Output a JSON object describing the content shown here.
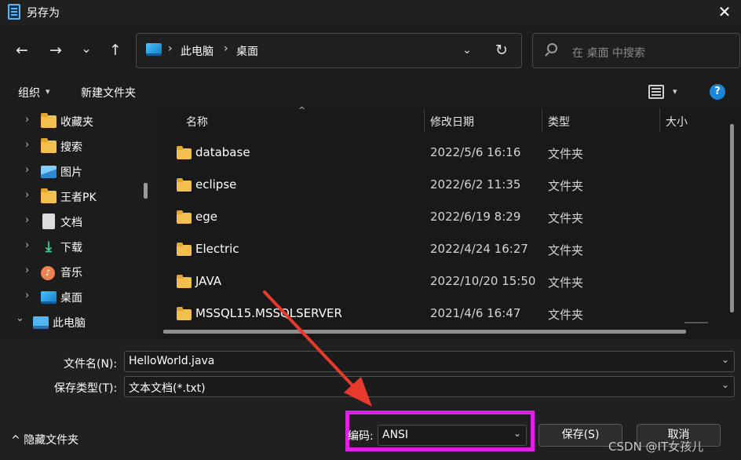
{
  "window": {
    "title": "另存为",
    "close_glyph": "✕"
  },
  "nav": {
    "back_glyph": "←",
    "forward_glyph": "→",
    "recent_glyph": "⌄",
    "up_glyph": "↑",
    "breadcrumb": [
      "此电脑",
      "桌面"
    ],
    "breadcrumb_sep": "›",
    "dropdown_glyph": "⌄",
    "refresh_glyph": "↻",
    "search_placeholder": "在 桌面 中搜索"
  },
  "commands": {
    "organize": "组织",
    "new_folder": "新建文件夹",
    "caret": "▾",
    "help": "?"
  },
  "sidebar": {
    "chevron": "›",
    "expanded_chevron": "⌄",
    "items": [
      {
        "label": "收藏夹",
        "icon": "folder-icon"
      },
      {
        "label": "搜索",
        "icon": "folder-icon"
      },
      {
        "label": "图片",
        "icon": "pictures-icon"
      },
      {
        "label": "王者PK",
        "icon": "folder-icon"
      },
      {
        "label": "文档",
        "icon": "documents-icon"
      },
      {
        "label": "下载",
        "icon": "download-icon",
        "glyph": "⤓"
      },
      {
        "label": "音乐",
        "icon": "music-icon",
        "glyph": "♪"
      },
      {
        "label": "桌面",
        "icon": "desktop-icon"
      },
      {
        "label": "此电脑",
        "icon": "pc-icon"
      }
    ]
  },
  "file_list": {
    "columns": {
      "name": "名称",
      "modified": "修改日期",
      "type": "类型",
      "size": "大小"
    },
    "sort_glyph": "^",
    "rows": [
      {
        "name": "database",
        "modified": "2022/5/6 16:16",
        "type": "文件夹"
      },
      {
        "name": "eclipse",
        "modified": "2022/6/2 11:35",
        "type": "文件夹"
      },
      {
        "name": "ege",
        "modified": "2022/6/19 8:29",
        "type": "文件夹"
      },
      {
        "name": "Electric",
        "modified": "2022/4/24 16:27",
        "type": "文件夹"
      },
      {
        "name": "JAVA",
        "modified": "2022/10/20 15:50",
        "type": "文件夹"
      },
      {
        "name": "MSSQL15.MSSQLSERVER",
        "modified": "2021/4/6 16:47",
        "type": "文件夹"
      }
    ]
  },
  "form": {
    "filename_label": "文件名(N):",
    "filename_value": "HelloWorld.java",
    "filetype_label": "保存类型(T):",
    "filetype_value": "文本文档(*.txt)",
    "encoding_label": "编码:",
    "encoding_value": "ANSI",
    "dropdown_glyph": "⌄",
    "save_button": "保存(S)",
    "cancel_button": "取消",
    "hide_folders": "隐藏文件夹",
    "hide_folders_glyph": "^"
  },
  "annotation": {
    "highlight_color": "#e11fe6",
    "arrow_color": "#e8392d"
  },
  "watermark": "CSDN @IT女孩儿"
}
